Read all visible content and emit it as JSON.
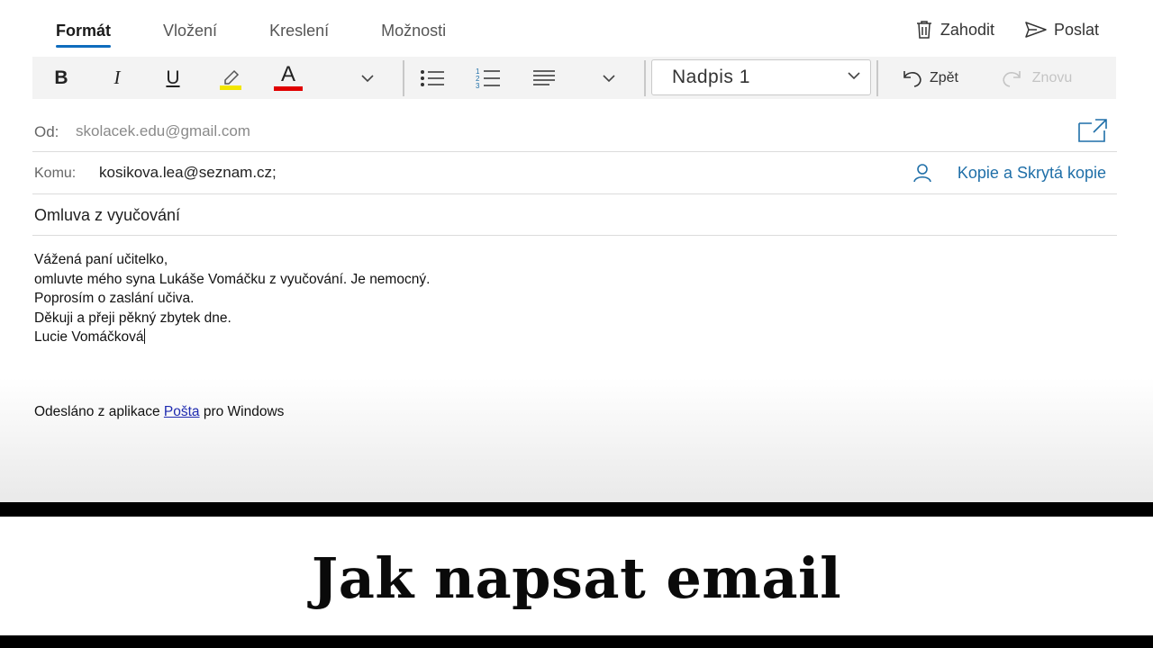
{
  "tabs": [
    {
      "label": "Formát",
      "active": true
    },
    {
      "label": "Vložení"
    },
    {
      "label": "Kreslení"
    },
    {
      "label": "Možnosti"
    }
  ],
  "actions": {
    "discard": "Zahodit",
    "send": "Poslat"
  },
  "toolbar": {
    "bold": "B",
    "italic": "I",
    "underline": "U",
    "font_color_letter": "A",
    "highlight_color": "#f2e600",
    "font_color": "#e00000",
    "style_value": "Nadpis 1",
    "undo": "Zpět",
    "redo": "Znovu"
  },
  "header": {
    "from_label": "Od:",
    "from_value": "skolacek.edu@gmail.com",
    "to_label": "Komu:",
    "to_value": "kosikova.lea@seznam.cz;",
    "cc_link": "Kopie a Skrytá kopie",
    "subject": "Omluva z vyučování"
  },
  "body": {
    "lines": [
      "Vážená paní učitelko,",
      "omluvte mého syna Lukáše Vomáčku z vyučování. Je nemocný.",
      "Poprosím o zaslání učiva.",
      "Děkuji a přeji pěkný zbytek dne.",
      "Lucie Vomáčková"
    ]
  },
  "signature": {
    "prefix": "Odesláno z aplikace ",
    "link": "Pošta",
    "suffix": " pro Windows"
  },
  "banner": {
    "title": "Jak napsat email"
  },
  "colors": {
    "accent": "#0f6cbd",
    "link": "#1f6fa8"
  }
}
